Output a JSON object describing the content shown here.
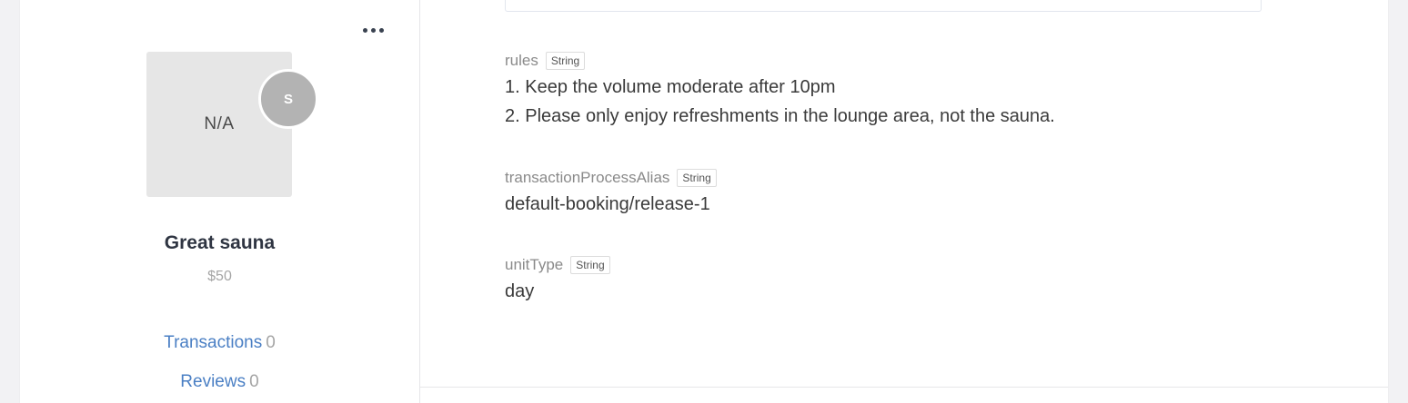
{
  "listing": {
    "image_placeholder": "N/A",
    "avatar_initial": "S",
    "title": "Great sauna",
    "price": "$50"
  },
  "stats": {
    "transactions_label": "Transactions",
    "transactions_count": "0",
    "reviews_label": "Reviews",
    "reviews_count": "0"
  },
  "fields": {
    "rules": {
      "name": "rules",
      "type": "String",
      "lines": [
        "1. Keep the volume moderate after 10pm",
        "2. Please only enjoy refreshments in the lounge area, not the sauna."
      ]
    },
    "transactionProcessAlias": {
      "name": "transactionProcessAlias",
      "type": "String",
      "value": "default-booking/release-1"
    },
    "unitType": {
      "name": "unitType",
      "type": "String",
      "value": "day"
    }
  },
  "icons": {
    "more": "more-horizontal-icon"
  },
  "colors": {
    "link": "#4a7fc4",
    "muted": "#a5a5a5",
    "title": "#2f3542",
    "avatar_bg": "#b3b3b3",
    "image_bg": "#e6e6e6"
  }
}
